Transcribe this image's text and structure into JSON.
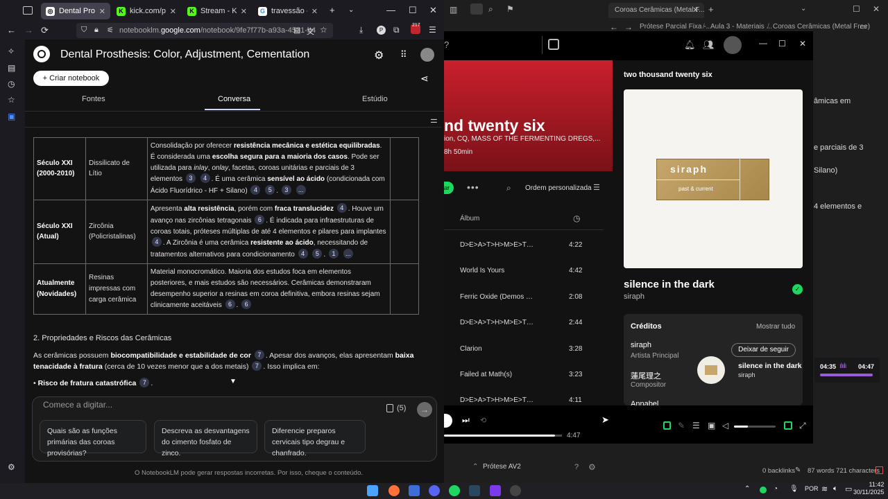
{
  "browser": {
    "tabs": [
      {
        "title": "Dental Prosthesis:",
        "active": true
      },
      {
        "title": "kick.com/popout/"
      },
      {
        "title": "Stream - Kick Dasl"
      },
      {
        "title": "travessão - Pesqui"
      }
    ],
    "url_prefix": "notebooklm.",
    "url_domain": "google.com",
    "url_suffix": "/notebook/9fe7f77b-a93a-4531-b4",
    "badge": "217"
  },
  "notebook": {
    "title": "Dental Prosthesis: Color, Adjustment, Cementation",
    "new_button": "+  Criar notebook",
    "tabs": [
      "Fontes",
      "Conversa",
      "Estúdio"
    ],
    "table_rows": [
      {
        "era": "Século XXI (2000-2010)",
        "material": "Dissilicato de Lítio",
        "desc_html": "Consolidação por oferecer <span class=\"b\">resistência mecânica e estética equilibradas</span>. É considerada uma <span class=\"b\">escolha segura para a maioria dos casos</span>. Pode ser utilizada para <i>inlay</i>, <i>onlay</i>, facetas, coroas unitárias e parciais de 3 elementos <span class=\"cite\">3</span> <span class=\"cite\">4</span>. É uma cerâmica <span class=\"b\">sensível ao ácido</span> (condicionada com Ácido Fluorídrico - HF + Silano) <span class=\"cite\">4</span> <span class=\"cite\">5</span>. <span class=\"cite\">3</span> <span class=\"cite\">...</span>"
      },
      {
        "era": "Século XXI (Atual)",
        "material": "Zircônia (Policristalinas)",
        "desc_html": "Apresenta <span class=\"b\">alta resistência</span>, porém com <span class=\"b\">fraca translucidez</span> <span class=\"cite\">4</span>. Houve um avanço nas zircônias tetragonais <span class=\"cite\">6</span>. É indicada para infraestruturas de coroas totais, próteses múltiplas de até 4 elementos e pilares para implantes <span class=\"cite\">4</span>. A Zircônia é uma cerâmica <span class=\"b\">resistente ao ácido</span>, necessitando de tratamentos alternativos para condicionamento <span class=\"cite\">4</span> <span class=\"cite\">5</span>. <span class=\"cite\">1</span> <span class=\"cite\">...</span>"
      },
      {
        "era": "Atualmente (Novidades)",
        "material": "Resinas impressas com carga cerâmica",
        "desc_html": "Material monocromático. Maioria dos estudos foca em elementos posteriores, e mais estudos são necessários. Cerâmicas demonstraram desempenho superior a resinas em coroa definitiva, embora resinas sejam clinicamente aceitáveis <span class=\"cite\">6</span>. <span class=\"cite\">6</span>"
      }
    ],
    "section_heading": "2. Propriedades e Riscos das Cerâmicas",
    "paragraph_html": "As cerâmicas possuem <span class=\"b\">biocompatibilidade e estabilidade de cor</span> <span class=\"cite\">7</span>. Apesar dos avanços, elas apresentam <span class=\"b\">baixa tenacidade à fratura</span> (cerca de 10 vezes menor que a dos metais) <span class=\"cite\">7</span>. Isso implica em:",
    "bullet_html": "• <span class=\"b\">Risco de fratura catastrófica</span> <span class=\"cite\">7</span>.",
    "input_placeholder": "Comece a digitar...",
    "source_count": "(5)",
    "suggestions": [
      "Quais são as funções primárias das coroas provisórias?",
      "Descreva as desvantagens do cimento fosfato de zinco.",
      "Diferencie preparos cervicais tipo degrau e chanfrado."
    ],
    "disclaimer": "O NotebookLM pode gerar respostas incorretas. Por isso, cheque o conteúdo."
  },
  "spotify": {
    "playlist_title": "nd twenty six",
    "playlist_meta": "ion, CQ, MASS OF THE FERMENTING DREGS,...",
    "playlist_duration": "8h 50min",
    "sort_label": "Ordem personalizada",
    "album_header": "Álbum",
    "tracks": [
      {
        "title": "D>E>A>T>H>M>E>T>...",
        "duration": "4:22"
      },
      {
        "title": "World Is Yours",
        "duration": "4:42"
      },
      {
        "title": "Ferric Oxide (Demos 19...",
        "duration": "2:08"
      },
      {
        "title": "D>E>A>T>H>M>E>T>...",
        "duration": "2:44"
      },
      {
        "title": "Clarion",
        "duration": "3:28"
      },
      {
        "title": "Failed at Math(s)",
        "duration": "3:23"
      },
      {
        "title": "D>E>A>T>H>M>E>T>...",
        "duration": "4:11"
      }
    ],
    "panel_title": "two thousand twenty six",
    "cover_text": "siraph",
    "cover_subtext": "past & current",
    "song_title": "silence in the dark",
    "song_artist": "siraph",
    "credits_title": "Créditos",
    "credits_show_all": "Mostrar tudo",
    "credits": [
      {
        "name": "siraph",
        "role": "Artista Principal"
      },
      {
        "name": "蓮尾理之",
        "role": "Compositor"
      },
      {
        "name": "Annabel",
        "role": ""
      }
    ],
    "unfollow_label": "Deixar de seguir",
    "total_time": "4:47",
    "progress_fraction": 0.94,
    "mini": {
      "title": "silence in the dark",
      "artist": "siraph",
      "current": "04:35",
      "total": "04:47"
    }
  },
  "obsidian": {
    "tab_title": "Coroas Cerâmicas (Metal F...",
    "breadcrumbs": [
      "Prótese Parcial Fixa -...",
      "Aula 3 - Materiais ...",
      "Coroas Cerâmicas (Metal Free)"
    ],
    "text_fragments": [
      "âmicas em",
      "e parciais de 3",
      "Silano)",
      "4 elementos e"
    ],
    "footer_file": "Prótese AV2",
    "backlinks": "0 backlinks",
    "stats": "87 words  721 characters"
  },
  "taskbar": {
    "lang": "POR",
    "time": "11:42",
    "date": "30/11/2025"
  },
  "colors": {
    "spotify_green": "#1ed760",
    "playlist_red": "#c9202c",
    "mini_progress": "#9c5bd9"
  }
}
